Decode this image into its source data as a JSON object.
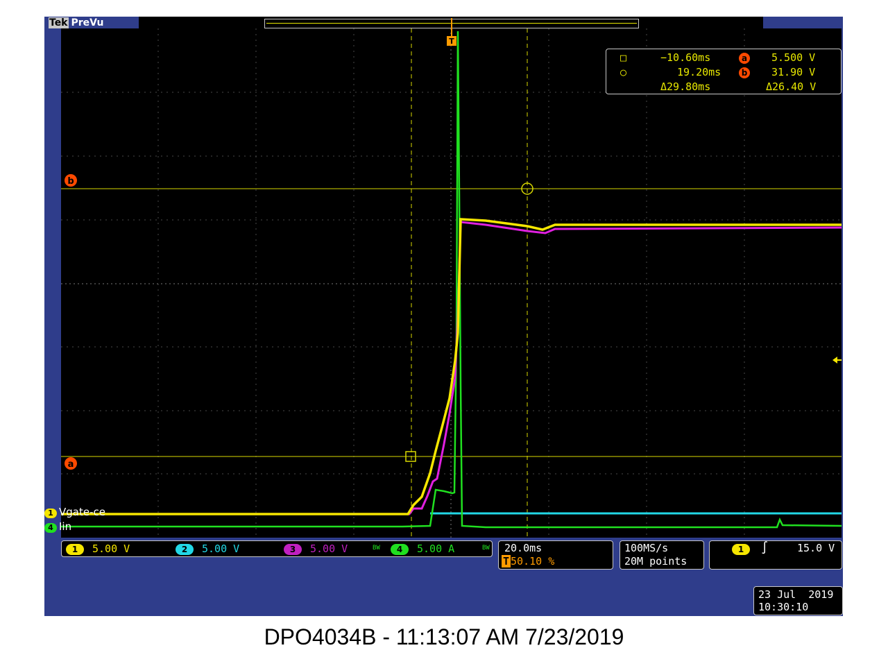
{
  "header": {
    "brand": "Tek",
    "mode": "PreVu"
  },
  "colors": {
    "ch1": "#f5e600",
    "ch2": "#22d8e6",
    "ch3": "#e020e0",
    "ch4": "#20e020",
    "cursor": "#d9d900",
    "marker": "#ff4a00",
    "trigger": "#ff9b00"
  },
  "cursor_readout": {
    "cursor1_time": "−10.60ms",
    "cursor2_time": "19.20ms",
    "delta_time": "Δ29.80ms",
    "cursor_a_volt": "5.500 V",
    "cursor_b_volt": "31.90 V",
    "delta_volt": "Δ26.40 V",
    "marker_a": "a",
    "marker_b": "b"
  },
  "channel_labels": {
    "ch1_num": "1",
    "ch1_name": "Vgate-ce",
    "ch4_num": "4",
    "ch4_name": "Iin"
  },
  "markers": {
    "trigger_position": "T",
    "cursor_a": "a",
    "cursor_b": "b"
  },
  "status": {
    "ch1": {
      "num": "1",
      "scale": "5.00 V"
    },
    "ch2": {
      "num": "2",
      "scale": "5.00 V"
    },
    "ch3": {
      "num": "3",
      "scale": "5.00 V"
    },
    "ch4": {
      "num": "4",
      "scale": "5.00 A"
    },
    "bw_mark": "BW",
    "timebase": "20.0ms",
    "trigger_pos": "50.10 %",
    "sample_rate": "100MS/s",
    "record_length": "20M points",
    "trigger_source": "1",
    "trigger_level": "15.0 V",
    "date": "23 Jul  2019",
    "time": "10:30:10"
  },
  "caption": "DPO4034B - 11:13:07 AM   7/23/2019"
}
